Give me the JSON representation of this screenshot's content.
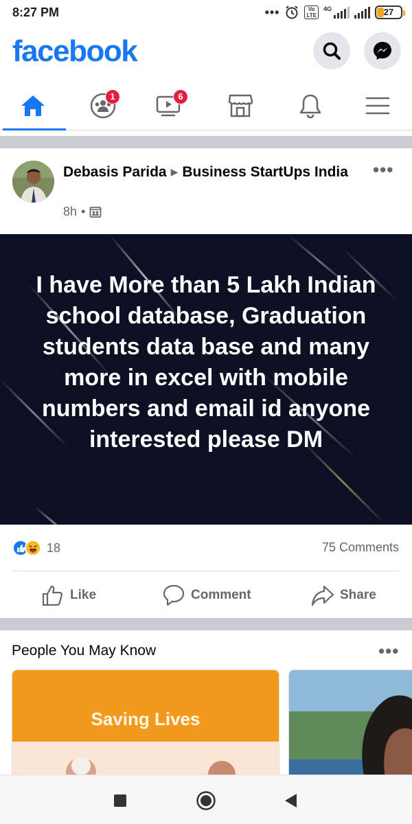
{
  "status_bar": {
    "time": "8:27 PM",
    "volte": "Vo LTE",
    "network": "4G",
    "battery": "27",
    "battery_level": 0.27,
    "icons": [
      "dots-icon",
      "alarm-icon",
      "volte-icon",
      "signal-icon",
      "battery-icon"
    ]
  },
  "header": {
    "logo": "facebook",
    "search_icon": "search-icon",
    "messenger_icon": "messenger-icon",
    "brand_color": "#1877f2"
  },
  "tabs": [
    {
      "name": "home",
      "icon": "home-icon",
      "active": true,
      "badge": ""
    },
    {
      "name": "groups",
      "icon": "groups-icon",
      "active": false,
      "badge": "1"
    },
    {
      "name": "watch",
      "icon": "watch-icon",
      "active": false,
      "badge": "6"
    },
    {
      "name": "marketplace",
      "icon": "marketplace-icon",
      "active": false,
      "badge": ""
    },
    {
      "name": "notifications",
      "icon": "bell-icon",
      "active": false,
      "badge": ""
    },
    {
      "name": "menu",
      "icon": "menu-icon",
      "active": false,
      "badge": ""
    }
  ],
  "post": {
    "author": "Debasis Parida",
    "group": "Business StartUps India",
    "time": "8h",
    "separator": "•",
    "image_text": "I have More than 5 Lakh Indian school database, Graduation students data base and many more in excel with mobile numbers and email id anyone interested please DM",
    "reaction_count": "18",
    "reactions": [
      "like",
      "haha"
    ],
    "comments": "75 Comments",
    "actions": {
      "like": "Like",
      "comment": "Comment",
      "share": "Share"
    }
  },
  "pymk": {
    "title": "People You May Know",
    "card1_text": "Saving Lives"
  },
  "nav_bar": {
    "icons": [
      "recents-icon",
      "home-circle-icon",
      "back-icon"
    ]
  }
}
